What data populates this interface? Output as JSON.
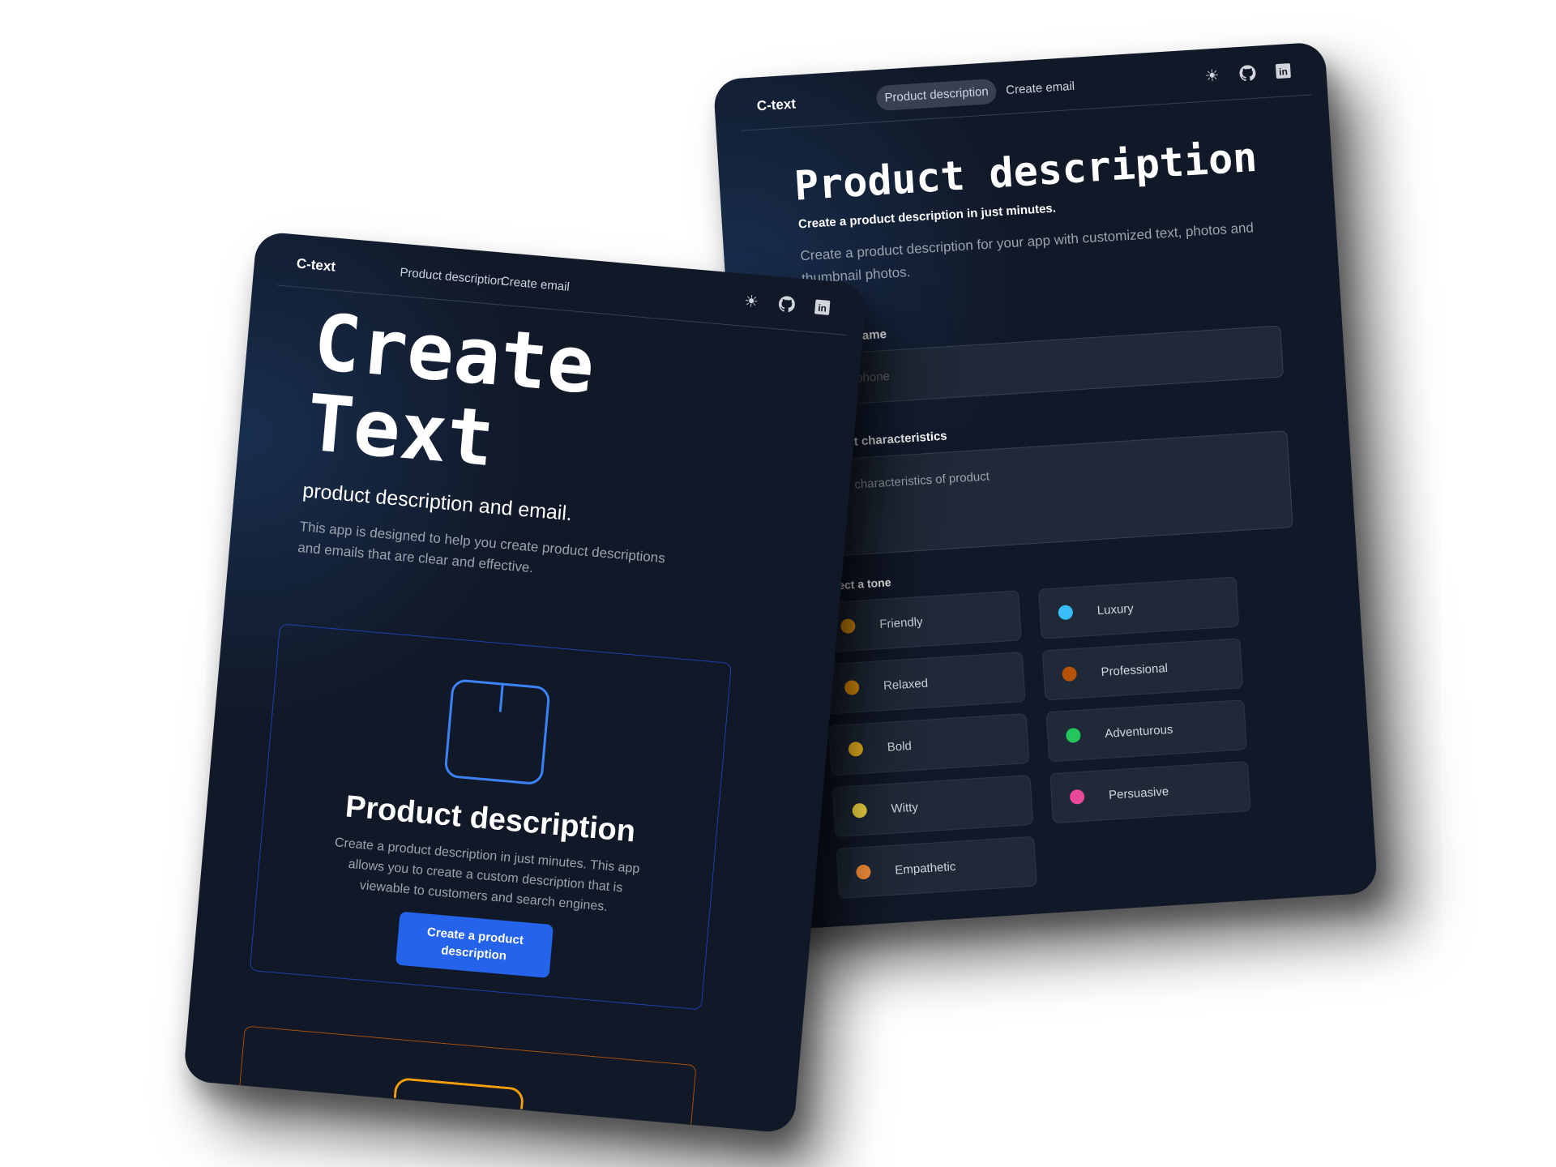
{
  "colors": {
    "background": "#111827",
    "accent": "#2563eb",
    "input_bg": "#1f2937",
    "secondary_accent": "#f59e0b"
  },
  "right_screen": {
    "logo": "C-text",
    "nav": [
      {
        "label": "Product description",
        "active": true
      },
      {
        "label": "Create email",
        "active": false
      }
    ],
    "icons": [
      "sun-icon",
      "github-icon",
      "linkedin-icon"
    ],
    "title": "Product description",
    "subtitle": "Create a product description in just minutes.",
    "description": "Create a product description for your app with customized text, photos and thumbnail photos.",
    "product_name": {
      "label": "Product name",
      "placeholder": "Smartphone"
    },
    "characteristics": {
      "label": "Product characteristics",
      "placeholder": "characteristics of product"
    },
    "tone_label": "Select a tone",
    "tones": [
      {
        "label": "Friendly",
        "icon": "smiling-face-icon",
        "color": "#f59e0b"
      },
      {
        "label": "Luxury",
        "icon": "gem-icon",
        "color": "#38bdf8"
      },
      {
        "label": "Relaxed",
        "icon": "relieved-face-icon",
        "color": "#f59e0b"
      },
      {
        "label": "Professional",
        "icon": "briefcase-icon",
        "color": "#b45309"
      },
      {
        "label": "Bold",
        "icon": "flexed-biceps-icon",
        "color": "#fbbf24"
      },
      {
        "label": "Adventurous",
        "icon": "hiker-icon",
        "color": "#22c55e"
      },
      {
        "label": "Witty",
        "icon": "light-bulb-icon",
        "color": "#fde047"
      },
      {
        "label": "Persuasive",
        "icon": "brain-icon",
        "color": "#ec4899"
      },
      {
        "label": "Empathetic",
        "icon": "hugging-face-icon",
        "color": "#fb923c"
      }
    ]
  },
  "left_screen": {
    "logo": "C-text",
    "nav": [
      {
        "label": "Product description"
      },
      {
        "label": "Create email"
      }
    ],
    "icons": [
      "sun-icon",
      "github-icon",
      "linkedin-icon"
    ],
    "title_line1": "Create",
    "title_line2": "Text",
    "subtitle": "product description and email.",
    "description": "This app is designed to help you create product descriptions and emails that are clear and effective.",
    "feature": {
      "title": "Product description",
      "description": "Create a product description in just minutes. This app allows you to create a custom description that is viewable to customers and search engines.",
      "button": "Create a product description"
    }
  }
}
